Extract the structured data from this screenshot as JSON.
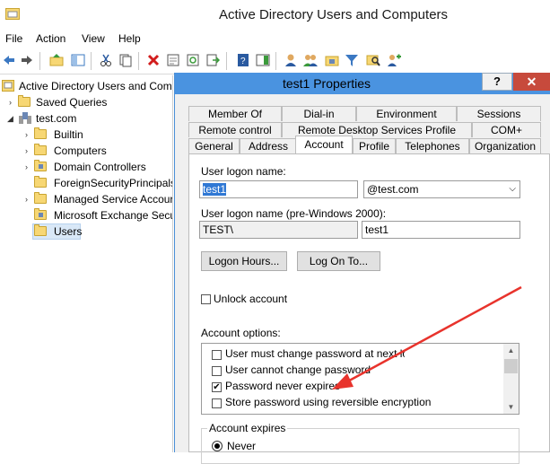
{
  "window": {
    "title": "Active Directory Users and Computers"
  },
  "menu": [
    "File",
    "Action",
    "View",
    "Help"
  ],
  "tree": {
    "root": "Active Directory Users and Com",
    "saved_queries": "Saved Queries",
    "domain": "test.com",
    "children": [
      "Builtin",
      "Computers",
      "Domain Controllers",
      "ForeignSecurityPrincipals",
      "Managed Service Accour",
      "Microsoft Exchange Secu",
      "Users"
    ]
  },
  "dialog": {
    "title": "test1 Properties",
    "help": "?",
    "close": "✕",
    "tabs_row1": [
      "Member Of",
      "Dial-in",
      "Environment",
      "Sessions"
    ],
    "tabs_row2": [
      "Remote control",
      "Remote Desktop Services Profile",
      "COM+"
    ],
    "tabs_row3": [
      "General",
      "Address",
      "Account",
      "Profile",
      "Telephones",
      "Organization"
    ],
    "account": {
      "logon_name_label": "User logon name:",
      "logon_name": "test1",
      "upn_suffix": "@test.com",
      "pre2000_label": "User logon name (pre-Windows 2000):",
      "pre2000_domain": "TEST\\",
      "pre2000_name": "test1",
      "logon_hours_button": "Logon Hours...",
      "log_on_to_button": "Log On To...",
      "unlock_label": "Unlock account",
      "options_label": "Account options:",
      "options": [
        {
          "label": "User must change password at next logon",
          "checked": false
        },
        {
          "label": "User cannot change password",
          "checked": false
        },
        {
          "label": "Password never expires",
          "checked": true
        },
        {
          "label": "Store password using reversible encryption",
          "checked": false
        }
      ],
      "expires_label": "Account expires",
      "never_label": "Never"
    }
  },
  "colors": {
    "dialog_title": "#4a93e0",
    "close": "#c74a3c",
    "selection": "#3078d4",
    "arrow": "#e8332c"
  }
}
